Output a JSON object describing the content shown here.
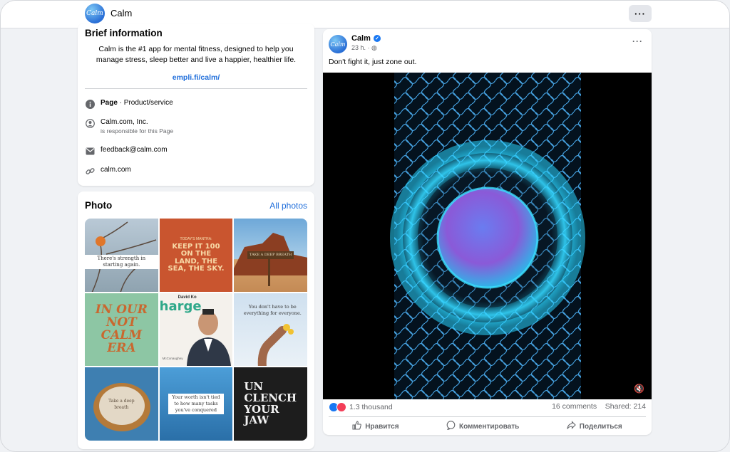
{
  "header": {
    "logo_text": "Calm",
    "title": "Calm",
    "more_icon": "more-horizontal-icon",
    "more_label": "···"
  },
  "info": {
    "heading": "Brief information",
    "description": "Calm is the #1 app for mental fitness, designed to help you manage stress, sleep better and live a happier, healthier life.",
    "link": "empli.fi/calm/",
    "rows": [
      {
        "icon": "info-icon",
        "bold": "Page",
        "text": " · Product/service"
      },
      {
        "icon": "person-icon",
        "text": "Calm.com, Inc.",
        "sub": "is responsible for this Page"
      },
      {
        "icon": "mail-icon",
        "text": "feedback@calm.com"
      },
      {
        "icon": "link-icon",
        "text": "calm.com"
      }
    ]
  },
  "photos": {
    "heading": "Photo",
    "all_label": "All photos",
    "tiles": [
      {
        "caption": "There's strength in starting again."
      },
      {
        "line1": "TODAY'S MANTRA:",
        "line2": "KEEP IT 100 ON THE LAND, THE SEA, THE SKY."
      },
      {
        "caption": "TAKE A DEEP BREATH"
      },
      {
        "line1": "IN OUR NOT",
        "line2": "CALM ERA"
      },
      {
        "name": "David Ko",
        "word": "harge",
        "small": "McConaughey"
      },
      {
        "caption": "You don't have to be everything for everyone."
      },
      {
        "caption": "Take a deep breath"
      },
      {
        "caption": "Your worth isn't tied to how many tasks you've conquered"
      },
      {
        "line1": "UN",
        "line2": "CLENCH",
        "line3": "YOUR",
        "line4": "JAW"
      }
    ]
  },
  "post": {
    "author": "Calm",
    "avatar_text": "Calm",
    "time": "23 h. · ",
    "text": "Don't fight it, just zone out.",
    "reactions": "1.3 thousand",
    "comments": "16 comments",
    "shared": "Shared: 214",
    "actions": {
      "like": "Нравится",
      "comment": "Комментировать",
      "share": "Поделиться"
    },
    "mute_icon": "muted-speaker-icon"
  },
  "colors": {
    "accent": "#216fdb",
    "brand_blue": "#1877f2",
    "background": "#f0f2f5"
  }
}
